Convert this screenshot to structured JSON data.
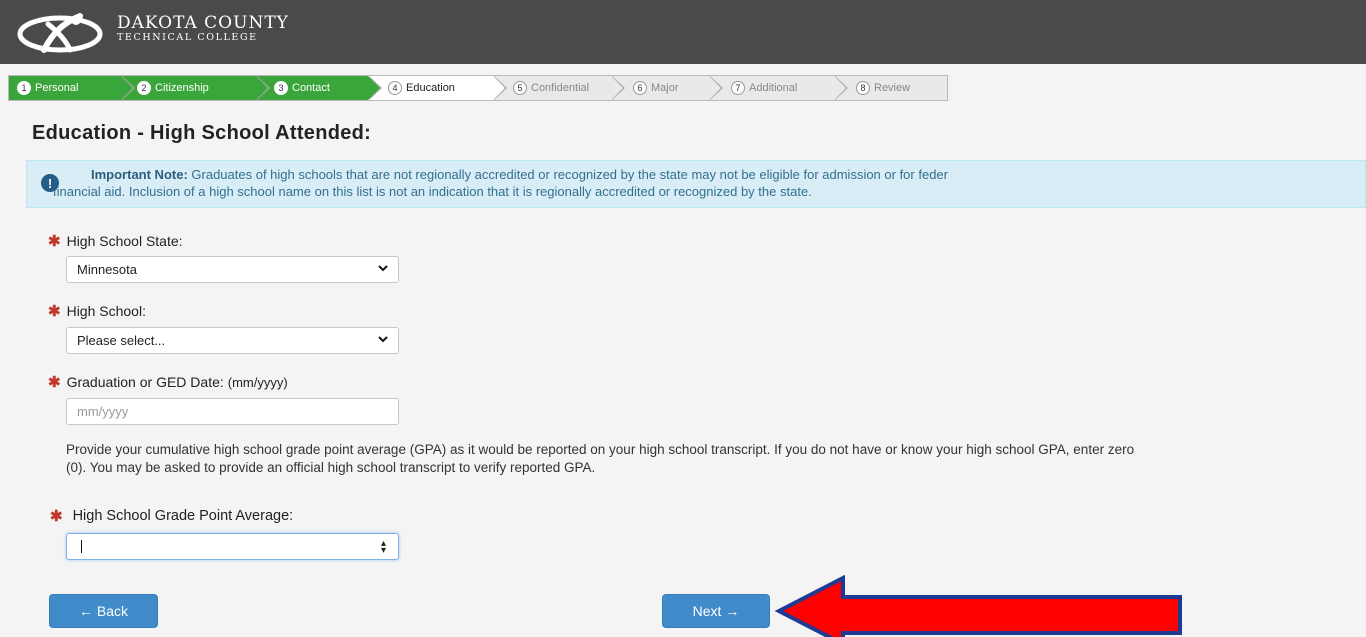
{
  "header": {
    "logo_line1": "DAKOTA COUNTY",
    "logo_line2": "TECHNICAL COLLEGE"
  },
  "steps": [
    {
      "num": "1",
      "label": "Personal",
      "state": "done"
    },
    {
      "num": "2",
      "label": "Citizenship",
      "state": "done"
    },
    {
      "num": "3",
      "label": "Contact",
      "state": "done"
    },
    {
      "num": "4",
      "label": "Education",
      "state": "current"
    },
    {
      "num": "5",
      "label": "Confidential",
      "state": "todo"
    },
    {
      "num": "6",
      "label": "Major",
      "state": "todo"
    },
    {
      "num": "7",
      "label": "Additional",
      "state": "todo"
    },
    {
      "num": "8",
      "label": "Review",
      "state": "todo"
    }
  ],
  "page": {
    "title": "Education - High School Attended:"
  },
  "note": {
    "icon": "!",
    "bold": "Important Note:",
    "line1": " Graduates of high schools that are not regionally accredited or recognized by the state may not be eligible for admission or for feder",
    "line2": "financial aid. Inclusion of a high school name on this list is not an indication that it is regionally accredited or recognized by the state."
  },
  "form": {
    "required_mark": "✱",
    "state_label": "High School State:",
    "state_value": "Minnesota",
    "school_label": "High School:",
    "school_value": "Please select...",
    "grad_label": "Graduation or GED Date:",
    "grad_hint": "(mm/yyyy)",
    "grad_placeholder": "mm/yyyy",
    "gpa_text": "Provide your cumulative high school grade point average (GPA) as it would be reported on your high school transcript. If you do not have or know your high school GPA, enter zero (0). You may be asked to provide an official high school transcript to verify reported GPA.",
    "gpa_label": "High School Grade Point Average:",
    "gpa_value": ""
  },
  "buttons": {
    "back": "← Back",
    "next": "Next →"
  },
  "colors": {
    "header_bg": "#4a4a4a",
    "step_done": "#3aa53a",
    "primary": "#428bca",
    "note_bg": "#d9edf7",
    "arrow_fill": "#ff0000",
    "arrow_stroke": "#1f3a93"
  }
}
